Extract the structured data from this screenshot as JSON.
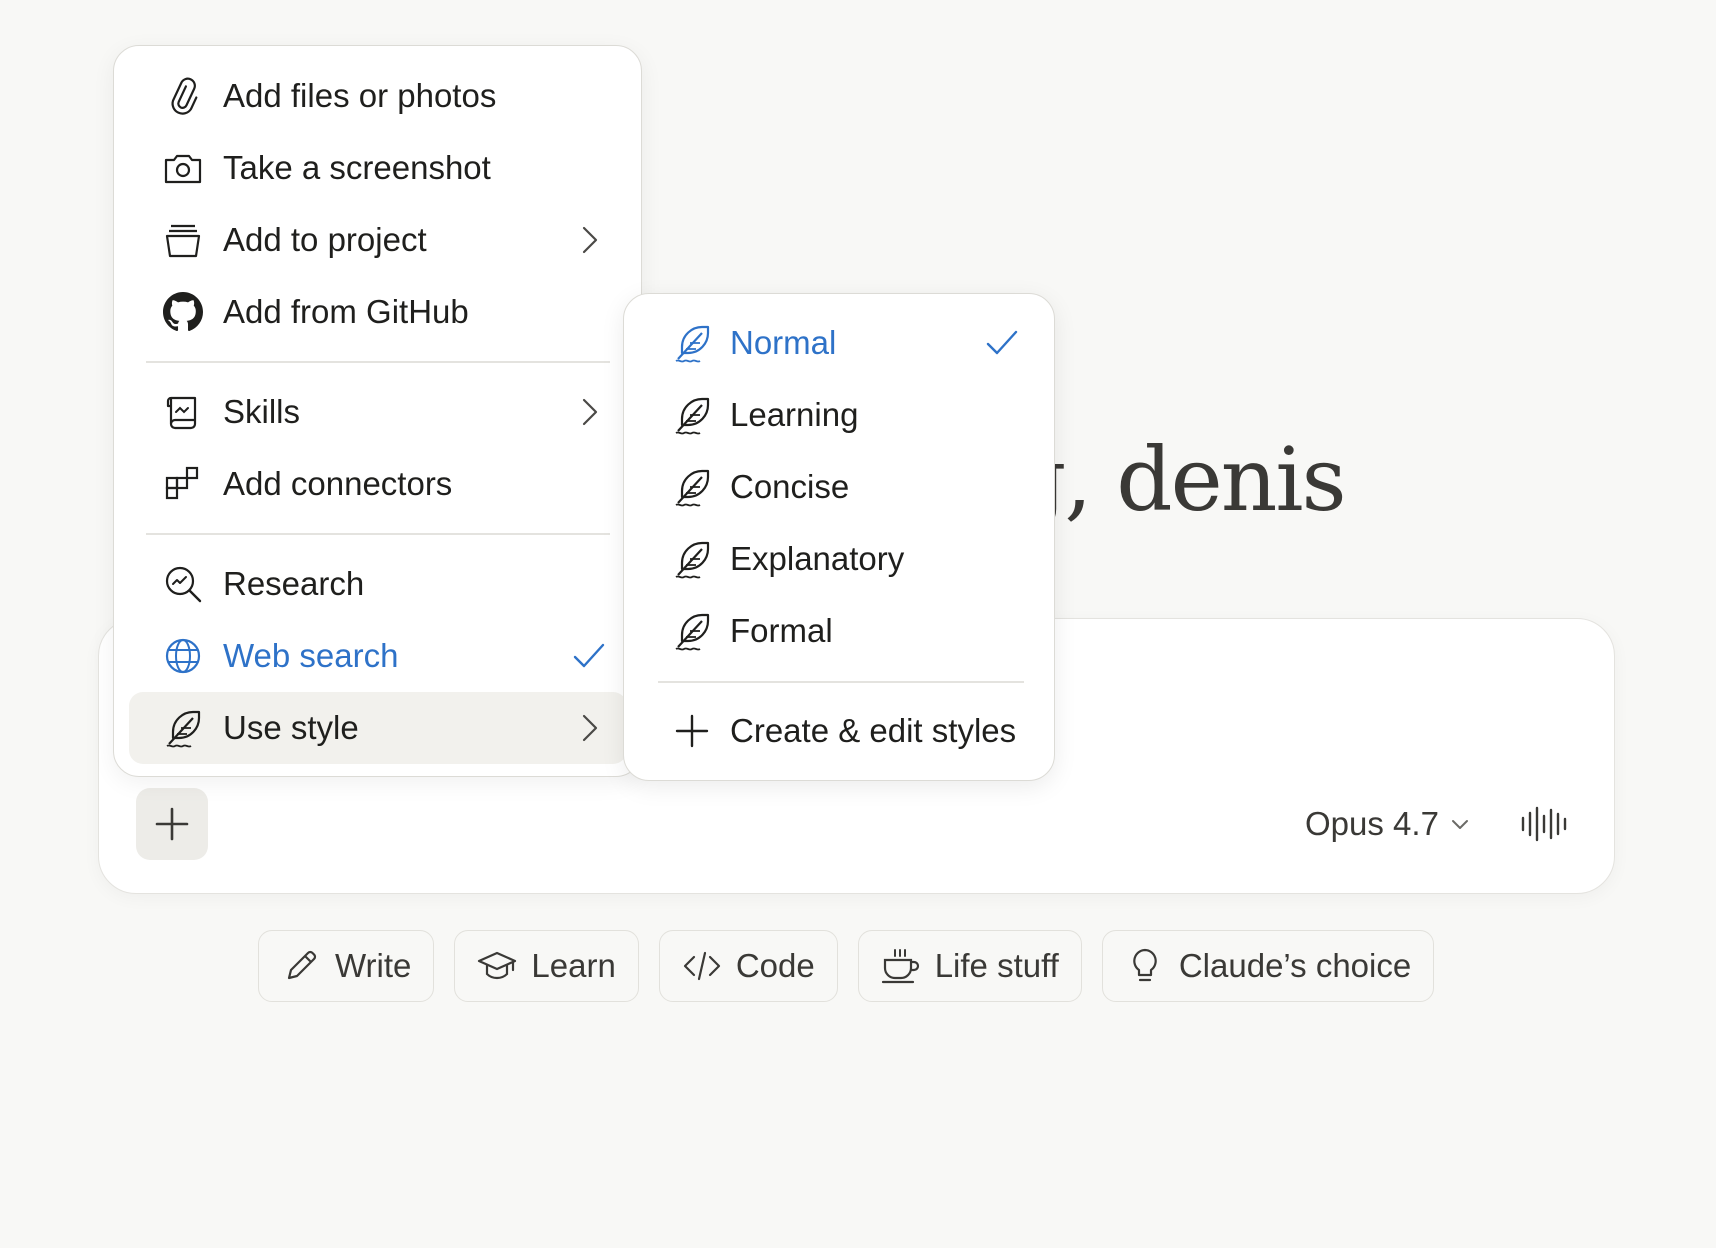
{
  "greeting": {
    "text": "g, denis"
  },
  "composer": {
    "model_label": "Opus 4.7"
  },
  "chips": [
    {
      "label": "Write"
    },
    {
      "label": "Learn"
    },
    {
      "label": "Code"
    },
    {
      "label": "Life stuff"
    },
    {
      "label": "Claude’s choice"
    }
  ],
  "menu": {
    "items": [
      {
        "label": "Add files or photos",
        "icon": "paperclip-icon"
      },
      {
        "label": "Take a screenshot",
        "icon": "camera-icon"
      },
      {
        "label": "Add to project",
        "icon": "project-icon"
      },
      {
        "label": "Add from GitHub",
        "icon": "github-icon"
      },
      {
        "label": "Skills",
        "icon": "skills-icon"
      },
      {
        "label": "Add connectors",
        "icon": "connectors-icon"
      },
      {
        "label": "Research",
        "icon": "research-icon"
      },
      {
        "label": "Web search",
        "icon": "globe-icon",
        "checked": true
      },
      {
        "label": "Use style",
        "icon": "feather-icon"
      }
    ]
  },
  "style_menu": {
    "items": [
      {
        "label": "Normal",
        "checked": true
      },
      {
        "label": "Learning"
      },
      {
        "label": "Concise"
      },
      {
        "label": "Explanatory"
      },
      {
        "label": "Formal"
      }
    ],
    "create_label": "Create & edit styles"
  },
  "colors": {
    "accent": "#2e72c8",
    "background": "#f8f8f6",
    "text": "#1f1f1d"
  }
}
